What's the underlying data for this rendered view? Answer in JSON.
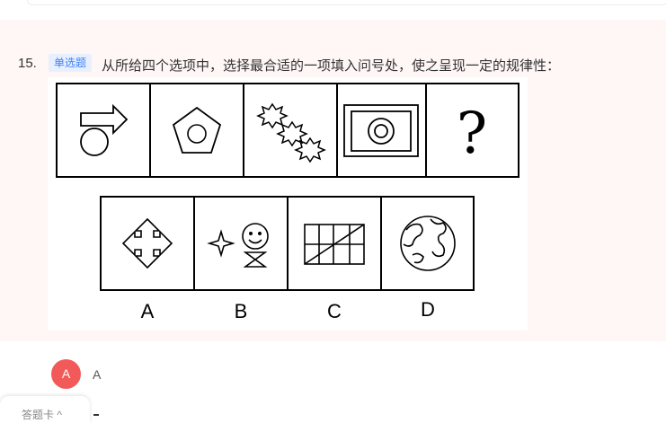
{
  "question": {
    "number": "15.",
    "type_tag": "单选题",
    "prompt": "从所给四个选项中，选择最合适的一项填入问号处，使之呈现一定的规律性：",
    "figure": {
      "question_mark": "?",
      "option_labels": [
        "A",
        "B",
        "C",
        "D"
      ]
    }
  },
  "answer": {
    "badge": "A",
    "text": "A",
    "badge_color": "#f25a5a"
  },
  "answer_card_tab": {
    "label": "答题卡 ^"
  },
  "colors": {
    "card_background": "#fff6f6",
    "tag_text": "#3d7ff5",
    "tag_background": "#e8f0ff"
  }
}
